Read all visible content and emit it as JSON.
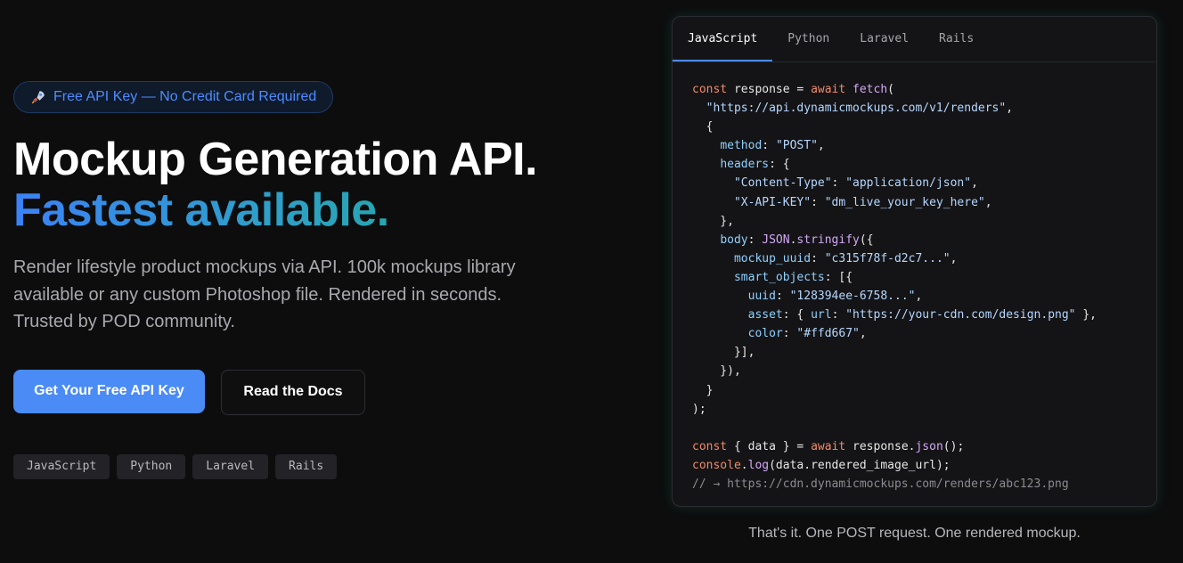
{
  "hero": {
    "badge": "Free API Key — No Credit Card Required",
    "badge_icon": "rocket-icon",
    "title_line1": "Mockup Generation API.",
    "title_line2": "Fastest available.",
    "description": "Render lifestyle product mockups via API. 100k mockups library available or any custom Photoshop file. Rendered in seconds. Trusted by POD community.",
    "primary_cta": "Get Your Free API Key",
    "secondary_cta": "Read the Docs",
    "tags": [
      "JavaScript",
      "Python",
      "Laravel",
      "Rails"
    ]
  },
  "code_panel": {
    "tabs": [
      "JavaScript",
      "Python",
      "Laravel",
      "Rails"
    ],
    "active_tab": "JavaScript",
    "code": [
      {
        "kind": "code",
        "parts": [
          [
            "k",
            "const"
          ],
          [
            "",
            "response = "
          ],
          [
            "k",
            "await"
          ],
          [
            "",
            ""
          ],
          [
            "f",
            "fetch"
          ],
          [
            "",
            "("
          ]
        ]
      },
      {
        "kind": "code",
        "parts": [
          [
            "",
            "  "
          ],
          [
            "s",
            "\"https://api.dynamicmockups.com/v1/renders\""
          ],
          [
            "",
            ","
          ]
        ]
      },
      {
        "kind": "code",
        "parts": [
          [
            "",
            "  {"
          ]
        ]
      },
      {
        "kind": "code",
        "parts": [
          [
            "",
            "    "
          ],
          [
            "p",
            "method"
          ],
          [
            "",
            ": "
          ],
          [
            "s",
            "\"POST\""
          ],
          [
            "",
            ","
          ]
        ]
      },
      {
        "kind": "code",
        "parts": [
          [
            "",
            "    "
          ],
          [
            "p",
            "headers"
          ],
          [
            "",
            ": {"
          ]
        ]
      },
      {
        "kind": "code",
        "parts": [
          [
            "",
            "      "
          ],
          [
            "s",
            "\"Content-Type\""
          ],
          [
            "",
            ": "
          ],
          [
            "s",
            "\"application/json\""
          ],
          [
            "",
            ","
          ]
        ]
      },
      {
        "kind": "code",
        "parts": [
          [
            "",
            "      "
          ],
          [
            "s",
            "\"X-API-KEY\""
          ],
          [
            "",
            ": "
          ],
          [
            "s",
            "\"dm_live_your_key_here\""
          ],
          [
            "",
            ","
          ]
        ]
      },
      {
        "kind": "code",
        "parts": [
          [
            "",
            "    },"
          ]
        ]
      },
      {
        "kind": "code",
        "parts": [
          [
            "",
            "    "
          ],
          [
            "p",
            "body"
          ],
          [
            "",
            ": "
          ],
          [
            "f",
            "JSON"
          ],
          [
            "",
            "."
          ],
          [
            "f",
            "stringify"
          ],
          [
            "",
            "({"
          ]
        ]
      },
      {
        "kind": "code",
        "parts": [
          [
            "",
            "      "
          ],
          [
            "p",
            "mockup_uuid"
          ],
          [
            "",
            ": "
          ],
          [
            "s",
            "\"c315f78f-d2c7...\""
          ],
          [
            "",
            ","
          ]
        ]
      },
      {
        "kind": "code",
        "parts": [
          [
            "",
            "      "
          ],
          [
            "p",
            "smart_objects"
          ],
          [
            "",
            ": [{"
          ]
        ]
      },
      {
        "kind": "code",
        "parts": [
          [
            "",
            "        "
          ],
          [
            "p",
            "uuid"
          ],
          [
            "",
            ": "
          ],
          [
            "s",
            "\"128394ee-6758...\""
          ],
          [
            "",
            ","
          ]
        ]
      },
      {
        "kind": "code",
        "parts": [
          [
            "",
            "        "
          ],
          [
            "p",
            "asset"
          ],
          [
            "",
            ": { "
          ],
          [
            "p",
            "url"
          ],
          [
            "",
            ": "
          ],
          [
            "s",
            "\"https://your-cdn.com/design.png\""
          ],
          [
            "",
            " },"
          ]
        ]
      },
      {
        "kind": "code",
        "parts": [
          [
            "",
            "        "
          ],
          [
            "p",
            "color"
          ],
          [
            "",
            ": "
          ],
          [
            "s",
            "\"#ffd667\""
          ],
          [
            "",
            ","
          ]
        ]
      },
      {
        "kind": "code",
        "parts": [
          [
            "",
            "      }],"
          ]
        ]
      },
      {
        "kind": "code",
        "parts": [
          [
            "",
            "    }),"
          ]
        ]
      },
      {
        "kind": "code",
        "parts": [
          [
            "",
            "  }"
          ]
        ]
      },
      {
        "kind": "code",
        "parts": [
          [
            "",
            ");"
          ]
        ]
      },
      {
        "kind": "code",
        "parts": [
          [
            "",
            ""
          ]
        ]
      },
      {
        "kind": "code",
        "parts": [
          [
            "k",
            "const"
          ],
          [
            "",
            " { data } = "
          ],
          [
            "k",
            "await"
          ],
          [
            "",
            " response."
          ],
          [
            "f",
            "json"
          ],
          [
            "",
            "();"
          ]
        ]
      },
      {
        "kind": "code",
        "parts": [
          [
            "k",
            "console"
          ],
          [
            "",
            "."
          ],
          [
            "f",
            "log"
          ],
          [
            "",
            "(data.rendered_image_url);"
          ]
        ]
      },
      {
        "kind": "code",
        "parts": [
          [
            "c",
            "// → https://cdn.dynamicmockups.com/renders/abc123.png"
          ]
        ]
      }
    ],
    "caption": "That's it. One POST request. One rendered mockup."
  },
  "colors": {
    "accent_blue": "#4a8bf5",
    "gradient_start": "#3b82f6",
    "gradient_end": "#1bb18a",
    "background": "#0d0d0e"
  }
}
